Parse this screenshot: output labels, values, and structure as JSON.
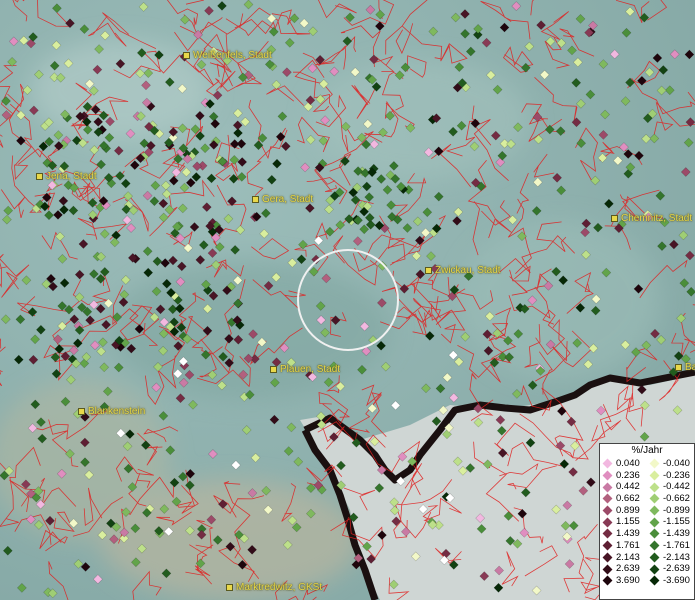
{
  "cities": [
    {
      "name": "Weißenfels, Stadt"
    },
    {
      "name": "Jena, Stadt"
    },
    {
      "name": "Gera, Stadt"
    },
    {
      "name": "Chemnitz, Stadt"
    },
    {
      "name": "Zwickau, Stadt"
    },
    {
      "name": "Plauen, Stadt"
    },
    {
      "name": "Blankenstein"
    },
    {
      "name": "Marktredwitz, GKSt"
    },
    {
      "name": "Ba"
    }
  ],
  "legend": {
    "title": "%/Jahr",
    "positive": [
      {
        "label": "0.040",
        "color": "#f2b8e0"
      },
      {
        "label": "0.236",
        "color": "#e08ec0"
      },
      {
        "label": "0.442",
        "color": "#c97aa4"
      },
      {
        "label": "0.662",
        "color": "#b2607e"
      },
      {
        "label": "0.899",
        "color": "#9c4a68"
      },
      {
        "label": "1.155",
        "color": "#883a55"
      },
      {
        "label": "1.439",
        "color": "#742c43"
      },
      {
        "label": "1.761",
        "color": "#5e1f33"
      },
      {
        "label": "2.143",
        "color": "#481525"
      },
      {
        "label": "2.639",
        "color": "#320c18"
      },
      {
        "label": "3.690",
        "color": "#1e050c"
      }
    ],
    "negative": [
      {
        "label": "-0.040",
        "color": "#f2f8c8"
      },
      {
        "label": "-0.236",
        "color": "#d9ee9e"
      },
      {
        "label": "-0.442",
        "color": "#bde08a"
      },
      {
        "label": "-0.662",
        "color": "#9fce74"
      },
      {
        "label": "-0.899",
        "color": "#7fb95e"
      },
      {
        "label": "-1.155",
        "color": "#62a44a"
      },
      {
        "label": "-1.439",
        "color": "#4a8e3a"
      },
      {
        "label": "-1.761",
        "color": "#34752c"
      },
      {
        "label": "-2.143",
        "color": "#225c1e"
      },
      {
        "label": "-2.639",
        "color": "#124212"
      },
      {
        "label": "-3.690",
        "color": "#062806"
      }
    ]
  },
  "highlight": "selection-circle"
}
